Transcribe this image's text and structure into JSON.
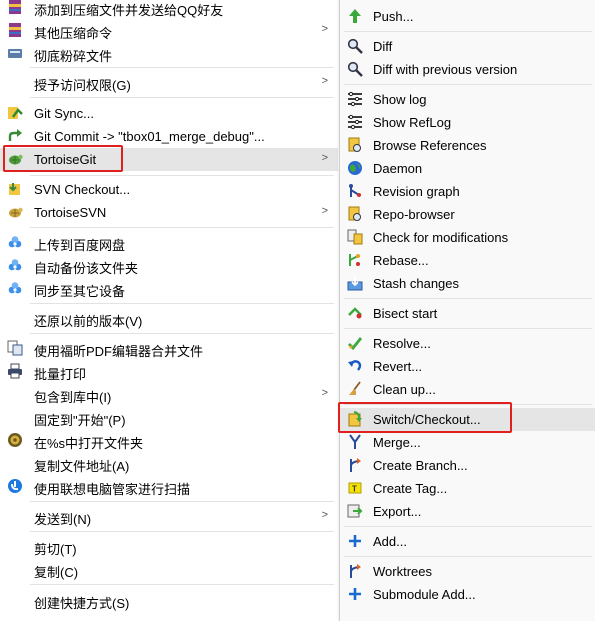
{
  "left_menu": {
    "items": [
      {
        "label": "添加到压缩文件并发送给QQ好友",
        "icon": "winrar-icon"
      },
      {
        "label": "其他压缩命令",
        "icon": "winrar-icon",
        "submenu": true
      },
      {
        "label": "彻底粉碎文件",
        "icon": "shredder-icon"
      },
      {
        "label": "授予访问权限(G)",
        "submenu": true
      },
      {
        "label": "Git Sync...",
        "icon": "git-sync-icon"
      },
      {
        "label": "Git Commit -> \"tbox01_merge_debug\"...",
        "icon": "git-commit-icon"
      },
      {
        "label": "TortoiseGit",
        "icon": "tortoisegit-icon",
        "submenu": true
      },
      {
        "label": "SVN Checkout...",
        "icon": "svn-checkout-icon"
      },
      {
        "label": "TortoiseSVN",
        "icon": "tortoisesvn-icon",
        "submenu": true
      },
      {
        "label": "上传到百度网盘",
        "icon": "baidu-cloud-icon"
      },
      {
        "label": "自动备份该文件夹",
        "icon": "baidu-cloud-icon"
      },
      {
        "label": "同步至其它设备",
        "icon": "baidu-cloud-icon"
      },
      {
        "label": "还原以前的版本(V)"
      },
      {
        "label": "使用福昕PDF编辑器合并文件",
        "icon": "pdf-merge-icon"
      },
      {
        "label": "批量打印",
        "icon": "printer-icon"
      },
      {
        "label": "包含到库中(I)",
        "submenu": true
      },
      {
        "label": "固定到\"开始\"(P)"
      },
      {
        "label": "在%s中打开文件夹",
        "icon": "folder-open-icon"
      },
      {
        "label": "复制文件地址(A)"
      },
      {
        "label": "使用联想电脑管家进行扫描",
        "icon": "lenovo-guard-icon"
      },
      {
        "label": "发送到(N)",
        "submenu": true
      },
      {
        "label": "剪切(T)"
      },
      {
        "label": "复制(C)"
      },
      {
        "label": "创建快捷方式(S)"
      }
    ]
  },
  "right_menu": {
    "items": [
      {
        "label": "Push...",
        "icon": "push-icon"
      },
      {
        "label": "Diff",
        "icon": "diff-icon"
      },
      {
        "label": "Diff with previous version",
        "icon": "diff-icon"
      },
      {
        "label": "Show log",
        "icon": "log-icon"
      },
      {
        "label": "Show RefLog",
        "icon": "log-icon"
      },
      {
        "label": "Browse References",
        "icon": "references-icon"
      },
      {
        "label": "Daemon",
        "icon": "globe-icon"
      },
      {
        "label": "Revision graph",
        "icon": "revision-graph-icon"
      },
      {
        "label": "Repo-browser",
        "icon": "repo-browser-icon"
      },
      {
        "label": "Check for modifications",
        "icon": "check-mods-icon"
      },
      {
        "label": "Rebase...",
        "icon": "rebase-icon"
      },
      {
        "label": "Stash changes",
        "icon": "stash-icon"
      },
      {
        "label": "Bisect start",
        "icon": "bisect-icon"
      },
      {
        "label": "Resolve...",
        "icon": "resolve-icon"
      },
      {
        "label": "Revert...",
        "icon": "revert-icon"
      },
      {
        "label": "Clean up...",
        "icon": "broom-icon"
      },
      {
        "label": "Switch/Checkout...",
        "icon": "switch-checkout-icon"
      },
      {
        "label": "Merge...",
        "icon": "merge-icon"
      },
      {
        "label": "Create Branch...",
        "icon": "branch-icon"
      },
      {
        "label": "Create Tag...",
        "icon": "tag-icon"
      },
      {
        "label": "Export...",
        "icon": "export-icon"
      },
      {
        "label": "Add...",
        "icon": "add-icon"
      },
      {
        "label": "Worktrees",
        "icon": "worktree-icon"
      },
      {
        "label": "Submodule Add...",
        "icon": "add-icon"
      }
    ]
  },
  "colors": {
    "highlight_box": "#e0201e",
    "hover": "#e5e5e5"
  }
}
